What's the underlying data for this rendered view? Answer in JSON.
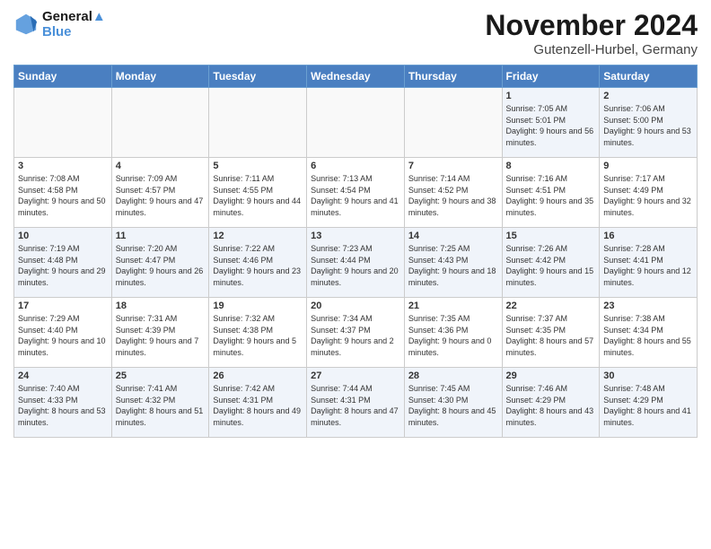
{
  "logo": {
    "line1": "General",
    "line2": "Blue"
  },
  "title": "November 2024",
  "subtitle": "Gutenzell-Hurbel, Germany",
  "days_of_week": [
    "Sunday",
    "Monday",
    "Tuesday",
    "Wednesday",
    "Thursday",
    "Friday",
    "Saturday"
  ],
  "weeks": [
    [
      {
        "day": "",
        "sunrise": "",
        "sunset": "",
        "daylight": ""
      },
      {
        "day": "",
        "sunrise": "",
        "sunset": "",
        "daylight": ""
      },
      {
        "day": "",
        "sunrise": "",
        "sunset": "",
        "daylight": ""
      },
      {
        "day": "",
        "sunrise": "",
        "sunset": "",
        "daylight": ""
      },
      {
        "day": "",
        "sunrise": "",
        "sunset": "",
        "daylight": ""
      },
      {
        "day": "1",
        "sunrise": "Sunrise: 7:05 AM",
        "sunset": "Sunset: 5:01 PM",
        "daylight": "Daylight: 9 hours and 56 minutes."
      },
      {
        "day": "2",
        "sunrise": "Sunrise: 7:06 AM",
        "sunset": "Sunset: 5:00 PM",
        "daylight": "Daylight: 9 hours and 53 minutes."
      }
    ],
    [
      {
        "day": "3",
        "sunrise": "Sunrise: 7:08 AM",
        "sunset": "Sunset: 4:58 PM",
        "daylight": "Daylight: 9 hours and 50 minutes."
      },
      {
        "day": "4",
        "sunrise": "Sunrise: 7:09 AM",
        "sunset": "Sunset: 4:57 PM",
        "daylight": "Daylight: 9 hours and 47 minutes."
      },
      {
        "day": "5",
        "sunrise": "Sunrise: 7:11 AM",
        "sunset": "Sunset: 4:55 PM",
        "daylight": "Daylight: 9 hours and 44 minutes."
      },
      {
        "day": "6",
        "sunrise": "Sunrise: 7:13 AM",
        "sunset": "Sunset: 4:54 PM",
        "daylight": "Daylight: 9 hours and 41 minutes."
      },
      {
        "day": "7",
        "sunrise": "Sunrise: 7:14 AM",
        "sunset": "Sunset: 4:52 PM",
        "daylight": "Daylight: 9 hours and 38 minutes."
      },
      {
        "day": "8",
        "sunrise": "Sunrise: 7:16 AM",
        "sunset": "Sunset: 4:51 PM",
        "daylight": "Daylight: 9 hours and 35 minutes."
      },
      {
        "day": "9",
        "sunrise": "Sunrise: 7:17 AM",
        "sunset": "Sunset: 4:49 PM",
        "daylight": "Daylight: 9 hours and 32 minutes."
      }
    ],
    [
      {
        "day": "10",
        "sunrise": "Sunrise: 7:19 AM",
        "sunset": "Sunset: 4:48 PM",
        "daylight": "Daylight: 9 hours and 29 minutes."
      },
      {
        "day": "11",
        "sunrise": "Sunrise: 7:20 AM",
        "sunset": "Sunset: 4:47 PM",
        "daylight": "Daylight: 9 hours and 26 minutes."
      },
      {
        "day": "12",
        "sunrise": "Sunrise: 7:22 AM",
        "sunset": "Sunset: 4:46 PM",
        "daylight": "Daylight: 9 hours and 23 minutes."
      },
      {
        "day": "13",
        "sunrise": "Sunrise: 7:23 AM",
        "sunset": "Sunset: 4:44 PM",
        "daylight": "Daylight: 9 hours and 20 minutes."
      },
      {
        "day": "14",
        "sunrise": "Sunrise: 7:25 AM",
        "sunset": "Sunset: 4:43 PM",
        "daylight": "Daylight: 9 hours and 18 minutes."
      },
      {
        "day": "15",
        "sunrise": "Sunrise: 7:26 AM",
        "sunset": "Sunset: 4:42 PM",
        "daylight": "Daylight: 9 hours and 15 minutes."
      },
      {
        "day": "16",
        "sunrise": "Sunrise: 7:28 AM",
        "sunset": "Sunset: 4:41 PM",
        "daylight": "Daylight: 9 hours and 12 minutes."
      }
    ],
    [
      {
        "day": "17",
        "sunrise": "Sunrise: 7:29 AM",
        "sunset": "Sunset: 4:40 PM",
        "daylight": "Daylight: 9 hours and 10 minutes."
      },
      {
        "day": "18",
        "sunrise": "Sunrise: 7:31 AM",
        "sunset": "Sunset: 4:39 PM",
        "daylight": "Daylight: 9 hours and 7 minutes."
      },
      {
        "day": "19",
        "sunrise": "Sunrise: 7:32 AM",
        "sunset": "Sunset: 4:38 PM",
        "daylight": "Daylight: 9 hours and 5 minutes."
      },
      {
        "day": "20",
        "sunrise": "Sunrise: 7:34 AM",
        "sunset": "Sunset: 4:37 PM",
        "daylight": "Daylight: 9 hours and 2 minutes."
      },
      {
        "day": "21",
        "sunrise": "Sunrise: 7:35 AM",
        "sunset": "Sunset: 4:36 PM",
        "daylight": "Daylight: 9 hours and 0 minutes."
      },
      {
        "day": "22",
        "sunrise": "Sunrise: 7:37 AM",
        "sunset": "Sunset: 4:35 PM",
        "daylight": "Daylight: 8 hours and 57 minutes."
      },
      {
        "day": "23",
        "sunrise": "Sunrise: 7:38 AM",
        "sunset": "Sunset: 4:34 PM",
        "daylight": "Daylight: 8 hours and 55 minutes."
      }
    ],
    [
      {
        "day": "24",
        "sunrise": "Sunrise: 7:40 AM",
        "sunset": "Sunset: 4:33 PM",
        "daylight": "Daylight: 8 hours and 53 minutes."
      },
      {
        "day": "25",
        "sunrise": "Sunrise: 7:41 AM",
        "sunset": "Sunset: 4:32 PM",
        "daylight": "Daylight: 8 hours and 51 minutes."
      },
      {
        "day": "26",
        "sunrise": "Sunrise: 7:42 AM",
        "sunset": "Sunset: 4:31 PM",
        "daylight": "Daylight: 8 hours and 49 minutes."
      },
      {
        "day": "27",
        "sunrise": "Sunrise: 7:44 AM",
        "sunset": "Sunset: 4:31 PM",
        "daylight": "Daylight: 8 hours and 47 minutes."
      },
      {
        "day": "28",
        "sunrise": "Sunrise: 7:45 AM",
        "sunset": "Sunset: 4:30 PM",
        "daylight": "Daylight: 8 hours and 45 minutes."
      },
      {
        "day": "29",
        "sunrise": "Sunrise: 7:46 AM",
        "sunset": "Sunset: 4:29 PM",
        "daylight": "Daylight: 8 hours and 43 minutes."
      },
      {
        "day": "30",
        "sunrise": "Sunrise: 7:48 AM",
        "sunset": "Sunset: 4:29 PM",
        "daylight": "Daylight: 8 hours and 41 minutes."
      }
    ]
  ]
}
